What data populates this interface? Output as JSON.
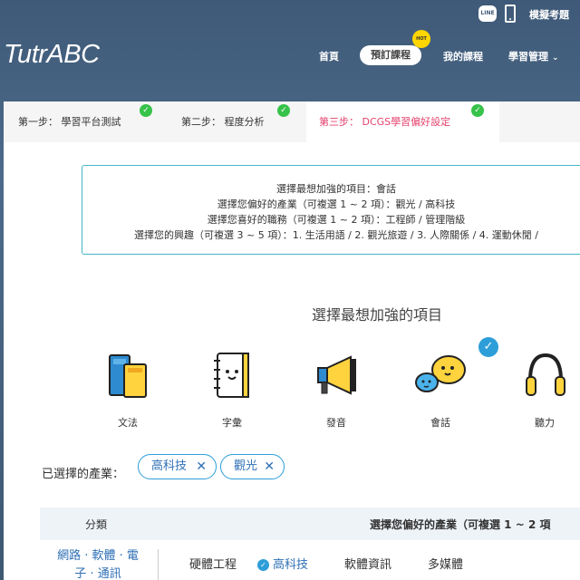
{
  "topbar": {
    "line_icon_text": "LINE",
    "mock_exam_label": "模擬考題"
  },
  "header": {
    "logo": {
      "part1": "Tut",
      "part2": "r",
      "part3": "ABC"
    },
    "nav": {
      "home": "首頁",
      "book_course": "預訂課程",
      "hot_badge": "HOT",
      "my_course": "我的課程",
      "learning_manage": "學習管理"
    }
  },
  "steps": [
    {
      "label": "第一步： 學習平台測試"
    },
    {
      "label": "第二步： 程度分析"
    },
    {
      "label": "第三步： DCGS學習偏好設定"
    }
  ],
  "summary": {
    "line1": "選擇最想加強的項目：會話",
    "line2": "選擇您偏好的產業（可複選 1 ~ 2 項）：觀光 / 高科技",
    "line3": "選擇您喜好的職務（可複選 1 ~ 2 項）：工程師 / 管理階級",
    "line4": "選擇您的興趣（可複選 3 ~ 5 項）：1. 生活用語 / 2. 觀光旅遊 / 3. 人際關係 / 4. 運動休閒 /"
  },
  "focus": {
    "title": "選擇最想加強的項目",
    "items": [
      {
        "label": "文法",
        "icon": "books-icon"
      },
      {
        "label": "字彙",
        "icon": "notebook-icon"
      },
      {
        "label": "發音",
        "icon": "megaphone-icon"
      },
      {
        "label": "會話",
        "icon": "chat-bubbles-icon",
        "selected": true
      },
      {
        "label": "聽力",
        "icon": "headphones-icon"
      }
    ]
  },
  "chosen_industries": {
    "label": "已選擇的產業：",
    "chips": [
      "高科技",
      "觀光"
    ]
  },
  "industry_table": {
    "header_category": "分類",
    "header_industry": "選擇您偏好的產業（可複選 1 ~ 2 項",
    "rows": [
      {
        "category_line1": "網路 · 軟體 · 電",
        "category_line2": "子 · 通訊",
        "options": [
          "硬體工程",
          "高科技",
          "軟體資訊",
          "多媒體"
        ]
      }
    ]
  },
  "colors": {
    "accent_blue": "#2e9ed9",
    "active_step": "#e4416d",
    "check_green": "#37c24a",
    "header_bg": "#3f5a78"
  }
}
